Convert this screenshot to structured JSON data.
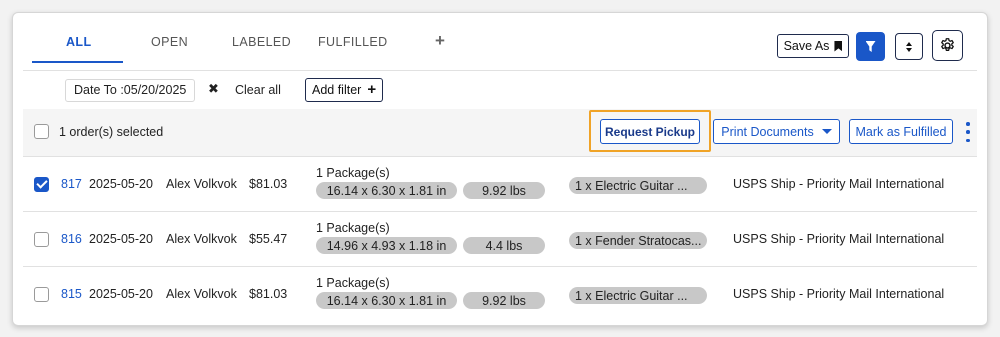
{
  "tabs": [
    {
      "label": "ALL",
      "active": true
    },
    {
      "label": "OPEN",
      "active": false
    },
    {
      "label": "LABELED",
      "active": false
    },
    {
      "label": "FULFILLED",
      "active": false
    }
  ],
  "tab_add_label": "+",
  "toolbar": {
    "save_as_label": "Save As"
  },
  "filters": {
    "date_chip": "Date To :05/20/2025",
    "clear_x": "✖",
    "clear_all_label": "Clear all",
    "add_filter_label": "Add filter",
    "add_filter_plus": "+"
  },
  "selection": {
    "text": "1 order(s) selected",
    "request_pickup_label": "Request Pickup",
    "print_documents_label": "Print Documents",
    "mark_fulfilled_label": "Mark as Fulfilled"
  },
  "colors": {
    "accent": "#1a57c8",
    "highlight": "#f0a326",
    "pill": "#c8c8c8"
  },
  "orders": [
    {
      "checked": true,
      "id": "817",
      "date": "2025-05-20",
      "customer": "Alex Volkvok",
      "amount": "$81.03",
      "packages": "1 Package(s)",
      "dimensions": "16.14 x 6.30 x 1.81 in",
      "weight": "9.92 lbs",
      "item": "1 x Electric Guitar ...",
      "carrier": "USPS Ship - Priority Mail International"
    },
    {
      "checked": false,
      "id": "816",
      "date": "2025-05-20",
      "customer": "Alex Volkvok",
      "amount": "$55.47",
      "packages": "1 Package(s)",
      "dimensions": "14.96 x 4.93 x 1.18 in",
      "weight": "4.4 lbs",
      "item": "1 x Fender Stratocas...",
      "carrier": "USPS Ship - Priority Mail International"
    },
    {
      "checked": false,
      "id": "815",
      "date": "2025-05-20",
      "customer": "Alex Volkvok",
      "amount": "$81.03",
      "packages": "1 Package(s)",
      "dimensions": "16.14 x 6.30 x 1.81 in",
      "weight": "9.92 lbs",
      "item": "1 x Electric Guitar ...",
      "carrier": "USPS Ship - Priority Mail International"
    }
  ]
}
